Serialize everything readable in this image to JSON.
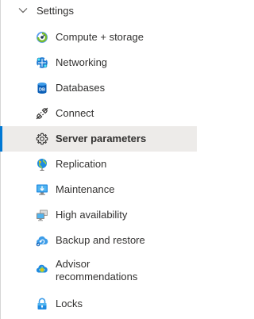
{
  "section": {
    "title": "Settings",
    "expanded": true,
    "icon": "chevron-down-icon"
  },
  "items": [
    {
      "label": "Compute + storage",
      "icon": "compute-storage-icon"
    },
    {
      "label": "Networking",
      "icon": "networking-icon"
    },
    {
      "label": "Databases",
      "icon": "databases-icon"
    },
    {
      "label": "Connect",
      "icon": "connect-icon"
    },
    {
      "label": "Server parameters",
      "icon": "gear-icon",
      "selected": true
    },
    {
      "label": "Replication",
      "icon": "replication-icon"
    },
    {
      "label": "Maintenance",
      "icon": "maintenance-icon"
    },
    {
      "label": "High availability",
      "icon": "high-availability-icon"
    },
    {
      "label": "Backup and restore",
      "icon": "backup-restore-icon"
    },
    {
      "label": "Advisor recommendations",
      "icon": "advisor-icon"
    },
    {
      "label": "Locks",
      "icon": "lock-icon"
    }
  ],
  "colors": {
    "selected_background": "#edebe9",
    "selected_accent": "#0078d4",
    "text": "#323130"
  }
}
